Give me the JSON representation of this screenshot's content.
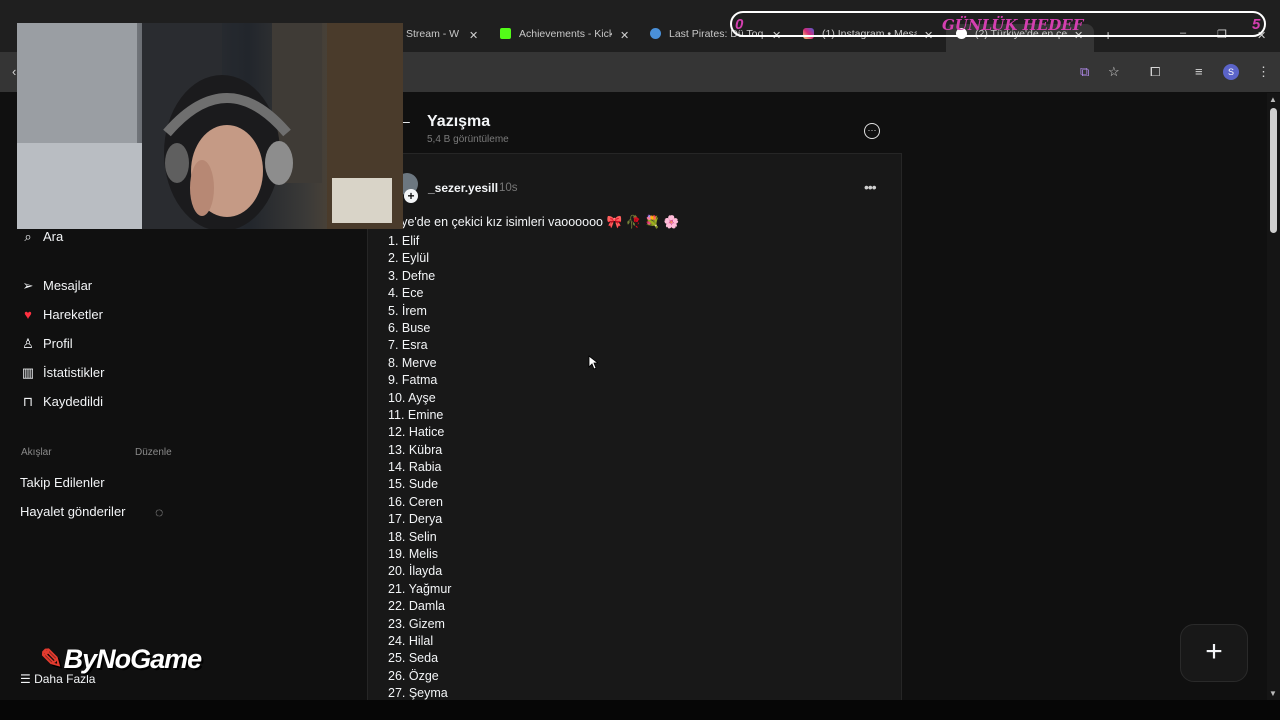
{
  "browser": {
    "tabs": [
      {
        "title": "Stream - W",
        "icon": "stream-icon",
        "color": "#6e6e6e"
      },
      {
        "title": "Achievements - Kick",
        "icon": "kick-icon",
        "color": "#53fc18"
      },
      {
        "title": "Last Pirates: Dü Toq",
        "icon": "steam-icon",
        "color": "#4a90d9"
      },
      {
        "title": "(1) Instagram • Mesa",
        "icon": "instagram-icon",
        "color": "#d6249f"
      },
      {
        "title": "(2) Türkiye'de en çek",
        "icon": "threads-icon",
        "color": "#ffffff"
      }
    ],
    "new_tab": "+",
    "profile_initial": "S"
  },
  "overlay": {
    "goal_min": "0",
    "goal_title": "GÜNLÜK HEDEF",
    "goal_max": "5",
    "logo_text": "ByNoGame"
  },
  "sidebar": {
    "items": [
      {
        "label": "Ara",
        "icon": "search-icon"
      },
      {
        "label": "Mesajlar",
        "icon": "send-icon"
      },
      {
        "label": "Hareketler",
        "icon": "heart-icon"
      },
      {
        "label": "Profil",
        "icon": "user-icon"
      },
      {
        "label": "İstatistikler",
        "icon": "stats-icon"
      },
      {
        "label": "Kaydedildi",
        "icon": "bookmark-icon"
      }
    ],
    "feeds_label": "Akışlar",
    "edit_label": "Düzenle",
    "feeds": [
      {
        "label": "Takip Edilenler"
      },
      {
        "label": "Hayalet gönderiler",
        "icon": "ghost-icon"
      }
    ],
    "more_label": "Daha Fazla"
  },
  "header": {
    "title": "Yazışma",
    "subtitle": "5,4 B görüntüleme"
  },
  "post": {
    "username": "_sezer.yesill",
    "time": "10s",
    "title": "rkiye'de en çekici kız isimleri vaoooooo 🎀 🥀 💐 🌸",
    "names": [
      "1. Elif",
      "2. Eylül",
      "3. Defne",
      "4. Ece",
      "5. İrem",
      "6. Buse",
      "7. Esra",
      "8. Merve",
      "9. Fatma",
      "10. Ayşe",
      "11. Emine",
      "12. Hatice",
      "13. Kübra",
      "14. Rabia",
      "15. Sude",
      "16. Ceren",
      "17. Derya",
      "18. Selin",
      "19. Melis",
      "20. İlayda",
      "21. Yağmur",
      "22. Damla",
      "23. Gizem",
      "24. Hilal",
      "25. Seda",
      "26. Özge",
      "27. Şeyma"
    ]
  },
  "fab_label": "+",
  "colors": {
    "background": "#101010",
    "accent_overlay": "#d43fb0",
    "text": "#f3f5f7",
    "muted": "#7a7a7a"
  }
}
